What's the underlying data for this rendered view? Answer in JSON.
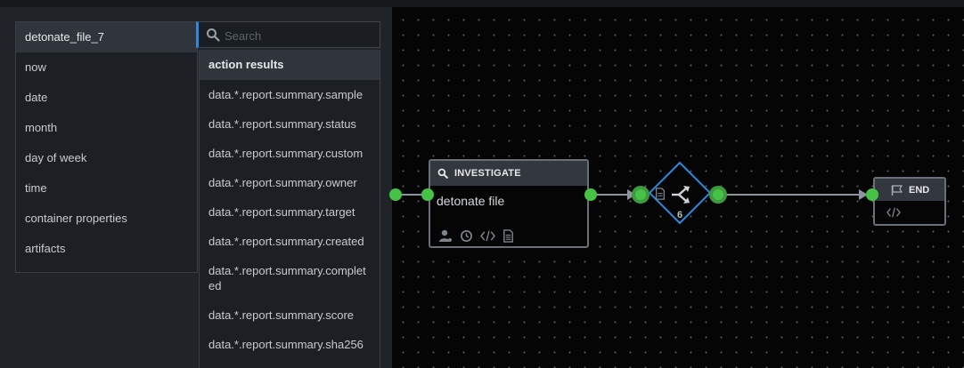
{
  "left_list": {
    "items": [
      "detonate_file_7",
      "now",
      "date",
      "month",
      "day of week",
      "time",
      "container properties",
      "artifacts"
    ],
    "selected_index": 0
  },
  "search": {
    "placeholder": "Search",
    "value": ""
  },
  "results": {
    "header": "action results",
    "items": [
      "data.*.report.summary.sample",
      "data.*.report.summary.status",
      "data.*.report.summary.custom",
      "data.*.report.summary.owner",
      "data.*.report.summary.target",
      "data.*.report.summary.created",
      "data.*.report.summary.completed",
      "data.*.report.summary.score",
      "data.*.report.summary.sha256"
    ]
  },
  "playbook": {
    "investigate": {
      "header": "INVESTIGATE",
      "name": "detonate file"
    },
    "decision": {
      "count": "6"
    },
    "end": {
      "label": "END"
    }
  },
  "colors": {
    "accent": "#2b8ae0",
    "port_green": "#46c346",
    "canvas": "#050505",
    "panel": "#202428"
  }
}
